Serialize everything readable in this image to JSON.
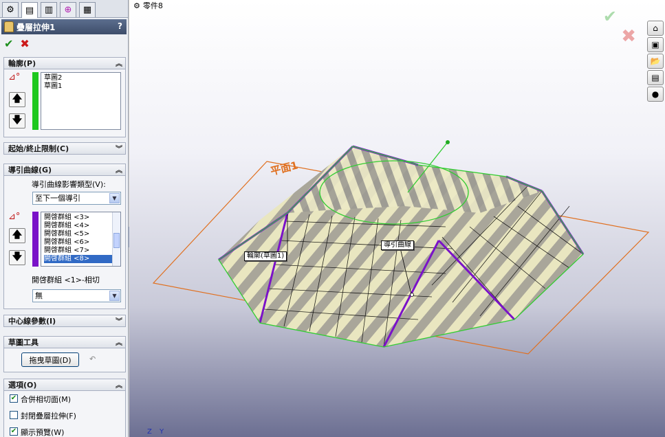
{
  "viewport": {
    "tree_item": "零件8"
  },
  "pm": {
    "title": "疊層拉伸1",
    "help": "?",
    "ok_icon": "✔",
    "cancel_icon": "✖",
    "groups": {
      "profiles": {
        "header": "輪廓(P)",
        "items": [
          "草圖2",
          "草圖1"
        ]
      },
      "constraints": {
        "header": "起始/終止限制(C)"
      },
      "guides": {
        "header": "導引曲線(G)",
        "influence_label": "導引曲線影響類型(V):",
        "influence_value": "至下一個導引",
        "items": [
          "開啓群組 <3>",
          "開啓群組 <4>",
          "開啓群組 <5>",
          "開啓群組 <6>",
          "開啓群組 <7>",
          "開啓群組 <8>"
        ],
        "tangency_label": "開啓群組 <1>-相切",
        "tangency_value": "無"
      },
      "centerline": {
        "header": "中心線參數(I)"
      },
      "sketch_tools": {
        "header": "草圖工具",
        "drag_button": "拖曳草圖(D)"
      },
      "options": {
        "header": "選項(O)",
        "merge": "合併相切面(M)",
        "close": "封閉疊層拉伸(F)",
        "preview": "顯示預覽(W)"
      }
    }
  },
  "callouts": {
    "plane": "平面1",
    "profile": "輪廓(草圖1)",
    "guide": "導引曲線"
  },
  "triad": {
    "z": "Z",
    "y": "Y"
  },
  "colors": {
    "accent_green": "#1ec81e",
    "accent_purple": "#7a12c8",
    "plane_orange": "#e07020"
  }
}
